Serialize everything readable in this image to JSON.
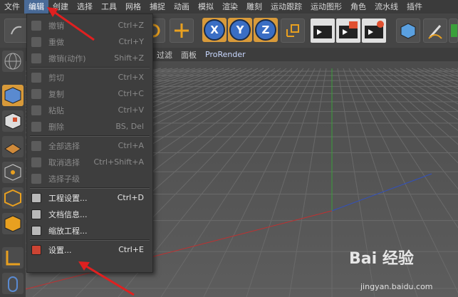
{
  "menubar": {
    "items": [
      "文件",
      "编辑",
      "创建",
      "选择",
      "工具",
      "网格",
      "捕捉",
      "动画",
      "模拟",
      "渲染",
      "雕刻",
      "运动跟踪",
      "运动图形",
      "角色",
      "流水线",
      "插件"
    ],
    "active_index": 1
  },
  "toolbar": {
    "axes": [
      "X",
      "Y",
      "Z"
    ]
  },
  "viewbar": {
    "items": [
      "过滤",
      "面板",
      "ProRender"
    ]
  },
  "menu": {
    "groups": [
      [
        {
          "label": "撤销",
          "shortcut": "Ctrl+Z",
          "enabled": false
        },
        {
          "label": "重做",
          "shortcut": "Ctrl+Y",
          "enabled": false
        },
        {
          "label": "撤销(动作)",
          "shortcut": "Shift+Z",
          "enabled": false
        }
      ],
      [
        {
          "label": "剪切",
          "shortcut": "Ctrl+X",
          "enabled": false
        },
        {
          "label": "复制",
          "shortcut": "Ctrl+C",
          "enabled": false
        },
        {
          "label": "粘贴",
          "shortcut": "Ctrl+V",
          "enabled": false
        },
        {
          "label": "删除",
          "shortcut": "BS, Del",
          "enabled": false
        }
      ],
      [
        {
          "label": "全部选择",
          "shortcut": "Ctrl+A",
          "enabled": false
        },
        {
          "label": "取消选择",
          "shortcut": "Ctrl+Shift+A",
          "enabled": false
        },
        {
          "label": "选择子级",
          "shortcut": "",
          "enabled": false
        }
      ],
      [
        {
          "label": "工程设置...",
          "shortcut": "Ctrl+D",
          "enabled": true
        },
        {
          "label": "文档信息...",
          "shortcut": "",
          "enabled": true
        },
        {
          "label": "缩放工程...",
          "shortcut": "",
          "enabled": true
        }
      ],
      [
        {
          "label": "设置...",
          "shortcut": "Ctrl+E",
          "enabled": true
        }
      ]
    ]
  },
  "watermark": {
    "brand": "Bai 经验",
    "url": "jingyan.baidu.com"
  },
  "colors": {
    "active_menu": "#4a6b98",
    "arrow": "#e02020",
    "axis_button": "#3a6ec4",
    "grid_green": "#3aa03a",
    "grid_red": "#c03030",
    "grid_blue": "#3050c0"
  }
}
